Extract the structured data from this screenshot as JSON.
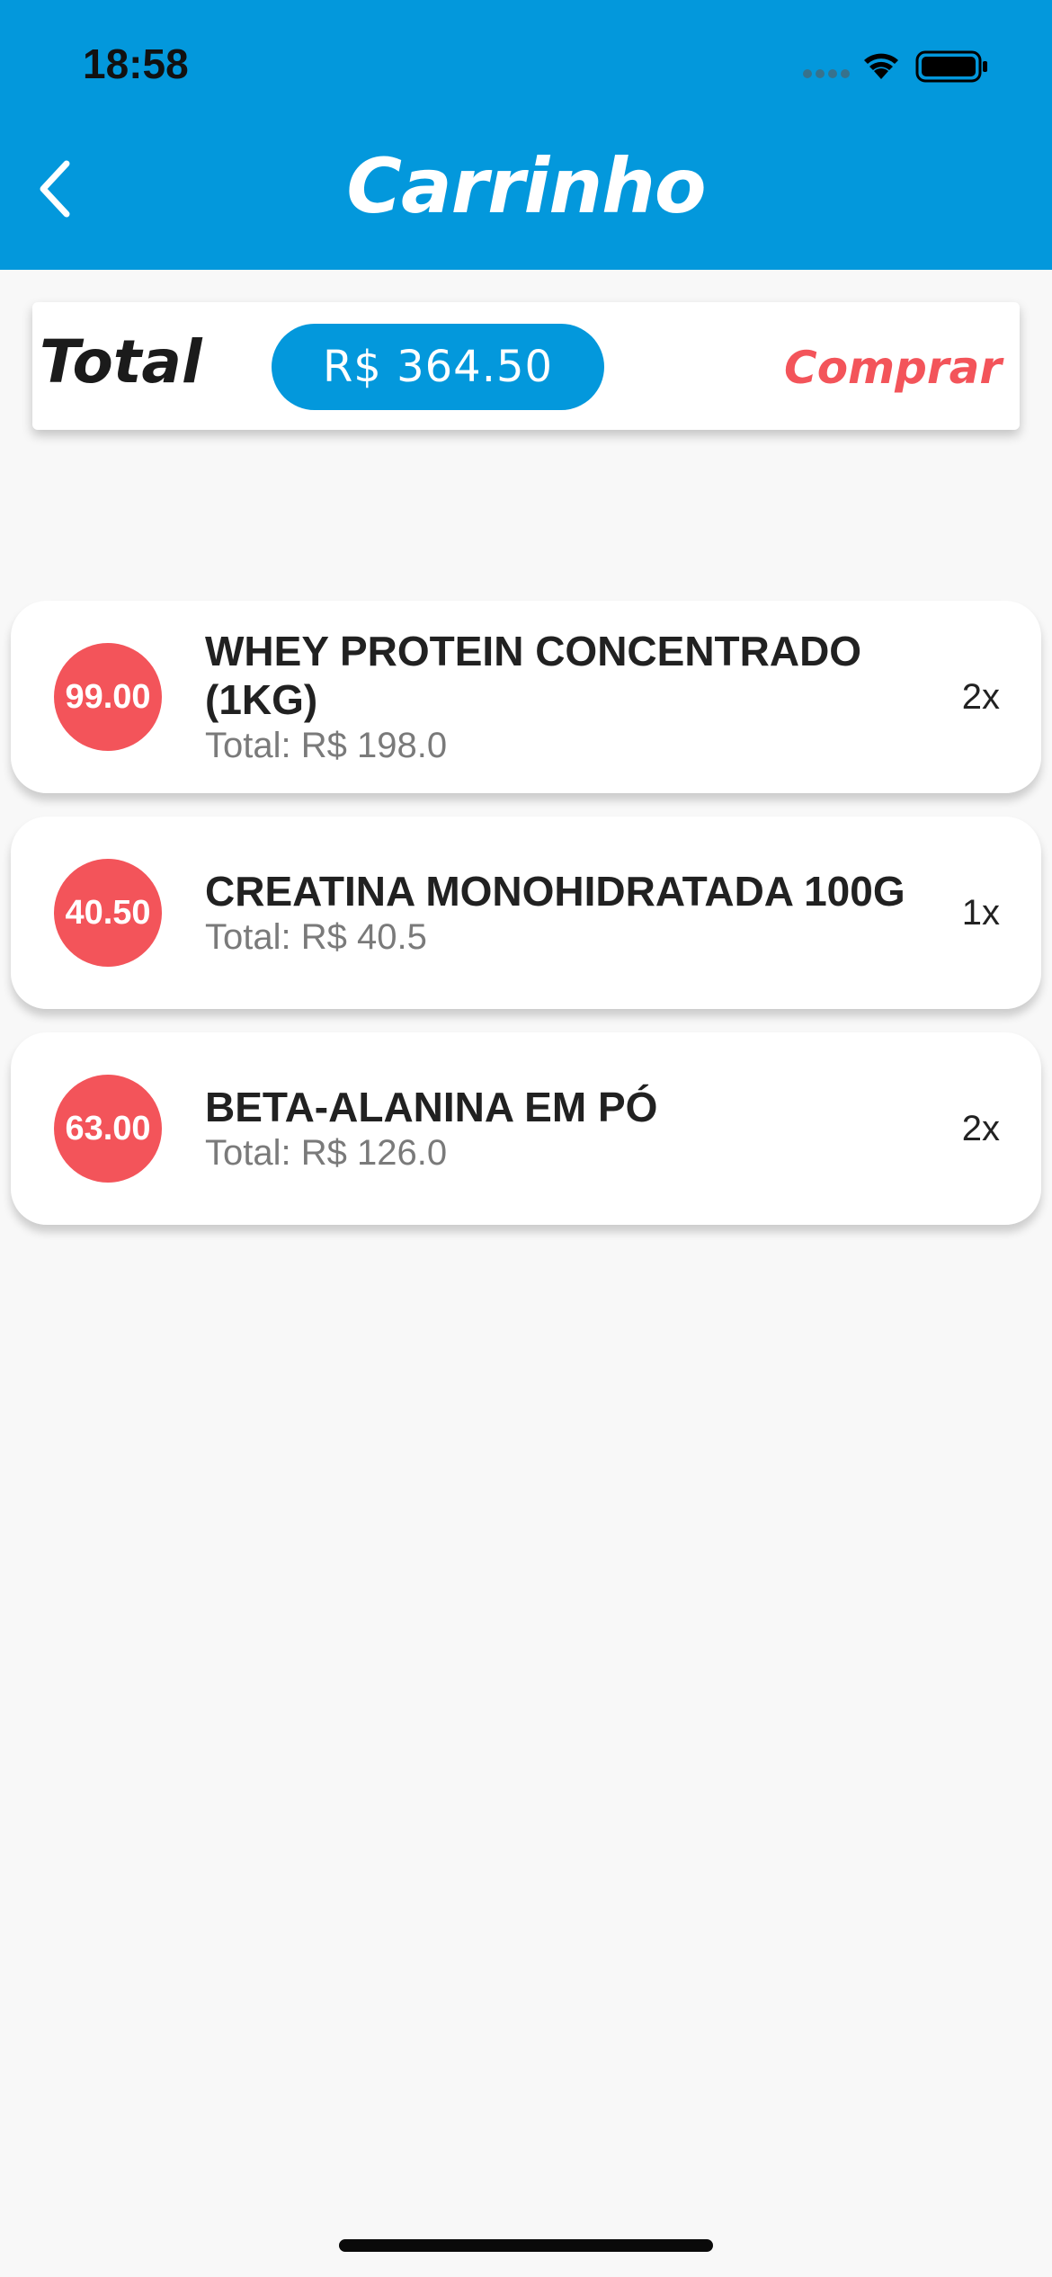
{
  "status_bar": {
    "time": "18:58"
  },
  "header": {
    "title": "Carrinho",
    "back_icon": "chevron-left-icon"
  },
  "summary": {
    "total_label": "Total",
    "total_value": "R$ 364.50",
    "buy_label": "Comprar"
  },
  "colors": {
    "primary": "#0398dc",
    "accent": "#f3545a",
    "background": "#f8f8f8"
  },
  "cart": {
    "items": [
      {
        "price": "99.00",
        "name": "WHEY PROTEIN CONCENTRADO (1KG)",
        "total": "Total: R$ 198.0",
        "qty": "2x"
      },
      {
        "price": "40.50",
        "name": "CREATINA MONOHIDRATADA 100G",
        "total": "Total: R$ 40.5",
        "qty": "1x"
      },
      {
        "price": "63.00",
        "name": "BETA-ALANINA EM PÓ",
        "total": "Total: R$ 126.0",
        "qty": "2x"
      }
    ]
  }
}
